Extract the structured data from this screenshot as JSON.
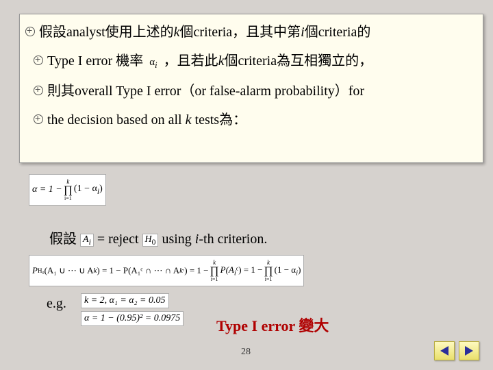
{
  "box": {
    "l1_a": "假設analyst使用上述的",
    "l1_b": "個criteria，且其中第",
    "l1_c": "個criteria的",
    "l2_a": "Type I error 機率",
    "l2_alpha": "α",
    "l2_sub": "i",
    "l2_b": "，且若此",
    "l2_c": "個criteria為互相獨立的，",
    "l3": "則其overall Type I error（or false-alarm probability）for",
    "l4_a": "the decision based on all ",
    "l4_b": " tests為：",
    "k": "k",
    "i": "i"
  },
  "formula_alpha": {
    "lhs": "α = 1 −",
    "prod_top": "k",
    "prod_bot": "i=1",
    "rhs": "(1 − α",
    "sub": "i",
    "close": ")"
  },
  "assume": {
    "pre": "假設",
    "Ai": "A",
    "Ai_sub": "i",
    "eq": " = reject ",
    "H0": "H",
    "H0_sub": "0",
    "post": " using ",
    "ith": "i",
    "tail": "-th criterion."
  },
  "formula_p": {
    "text_a": "P",
    "sub_a": "H₀",
    "paren_a": "(A₁ ∪ ⋯ ∪ A",
    "k1": "k",
    "mid": ") = 1 − P(A₁ᶜ ∩ ⋯ ∩ A",
    "k2": "k",
    "c": "ᶜ",
    "eq2": ") = 1 −",
    "prod1_top": "k",
    "prod1_bot": "i=1",
    "pai": "P(A",
    "i": "i",
    "cp": "ᶜ) = 1 −",
    "prod2_top": "k",
    "prod2_bot": "i=1",
    "tail": "(1 − α",
    "tail_i": "i",
    "close": ")"
  },
  "eg": {
    "label": "e.g.",
    "f1": "k = 2, α₁ = α₂ = 0.05",
    "f2": "α = 1 − (0.95)² = 0.0975"
  },
  "red": "Type I error 變大",
  "page": "28"
}
